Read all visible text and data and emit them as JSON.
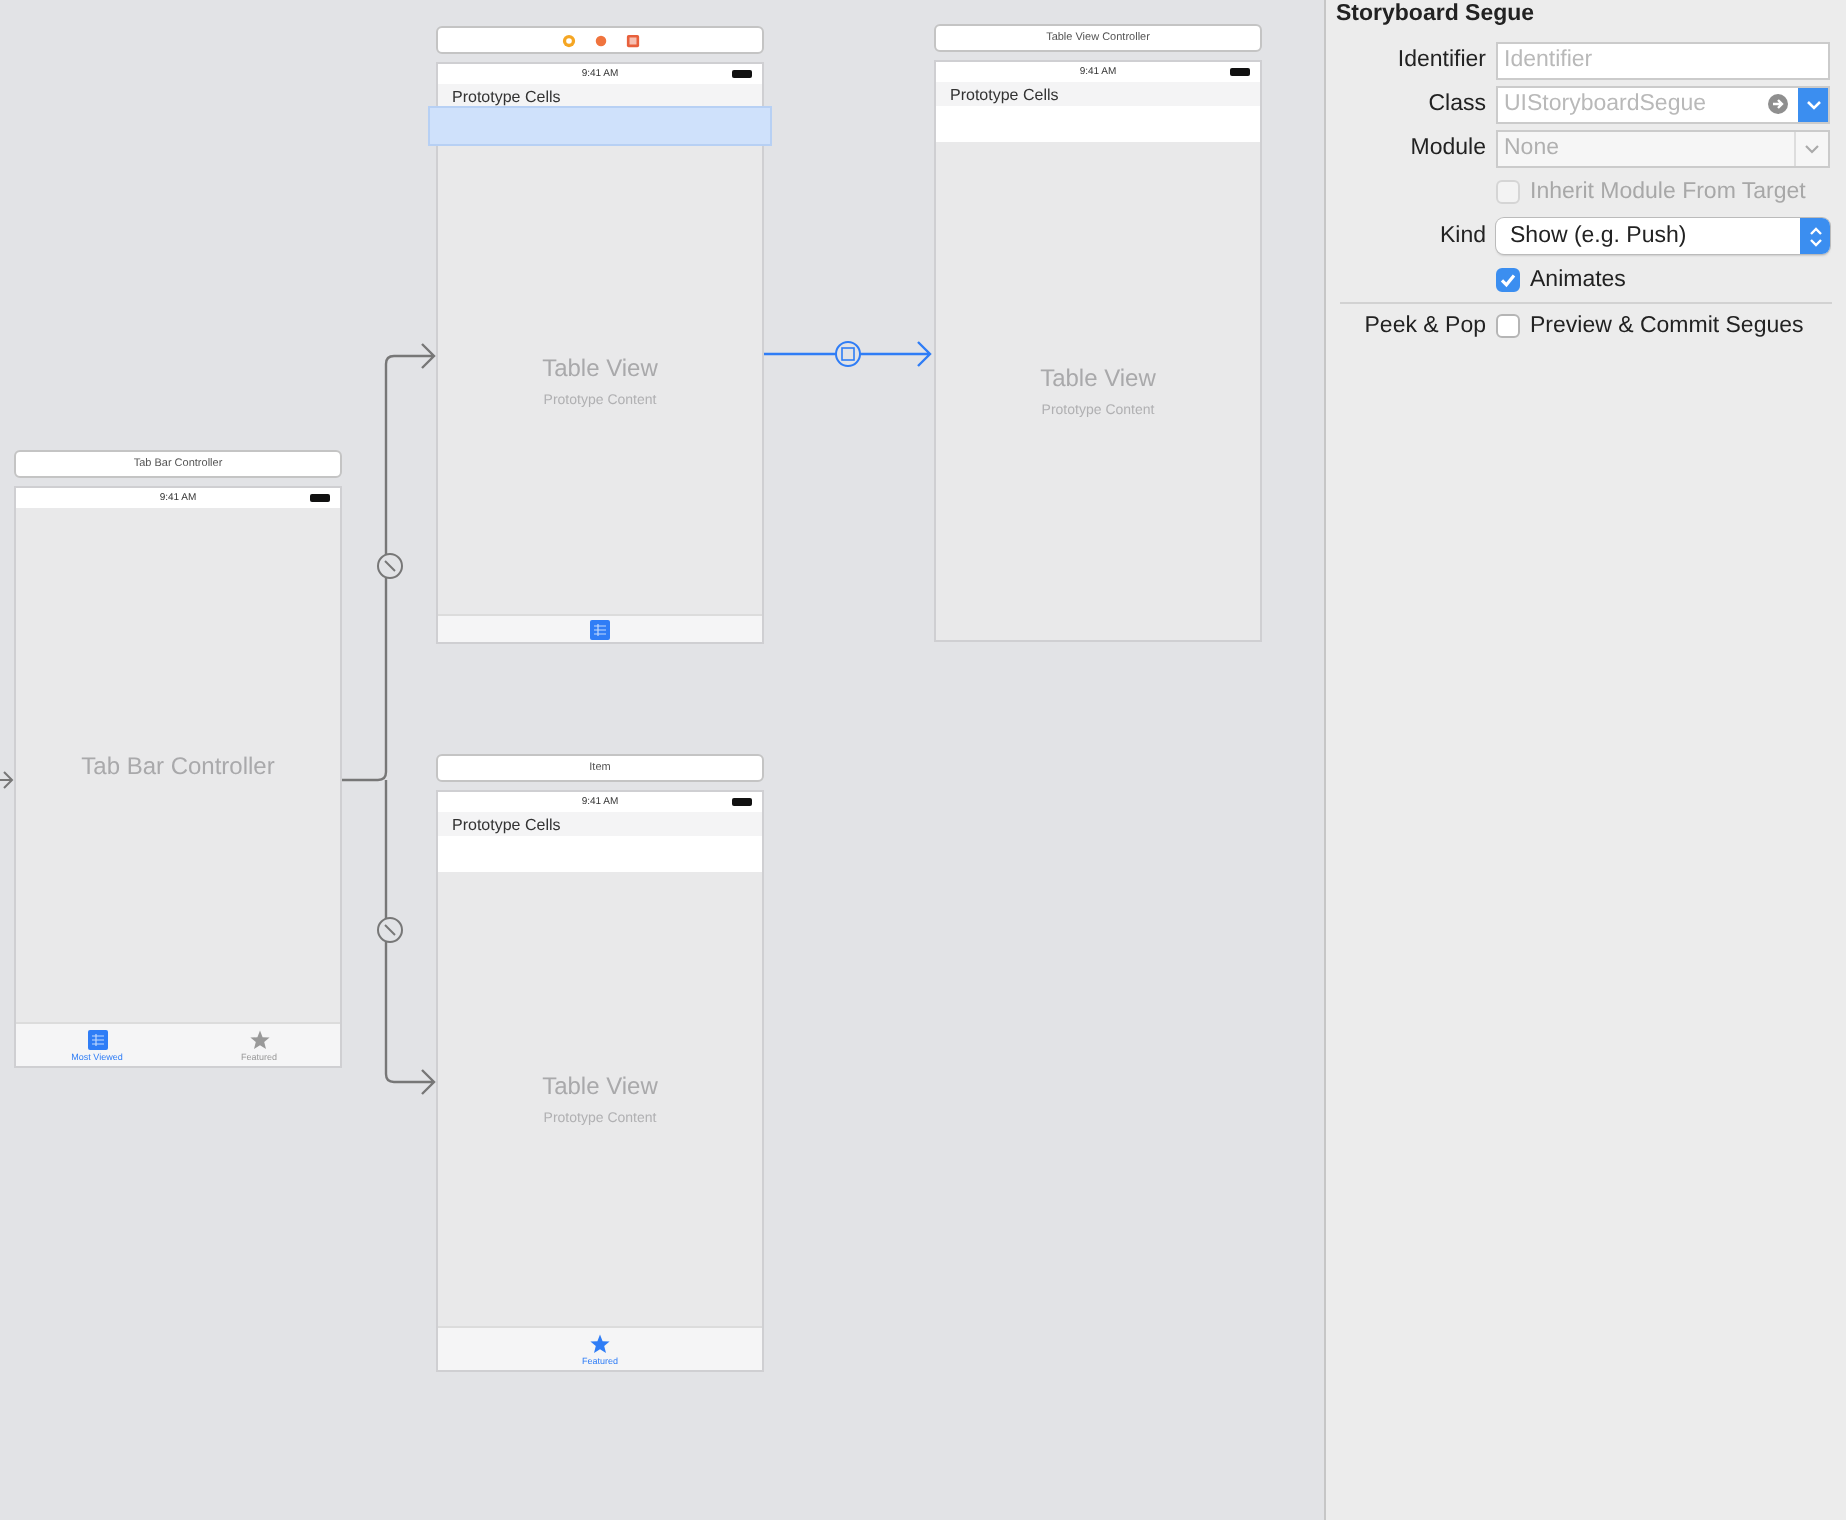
{
  "canvas": {
    "scenes": [
      {
        "kind": "tab_bar_controller",
        "title": "Tab Bar Controller",
        "status_time": "9:41 AM",
        "label": "Tab Bar Controller",
        "tab_items": [
          {
            "kind": "list",
            "label": "Most Viewed",
            "selected": true
          },
          {
            "kind": "star",
            "label": "Featured",
            "selected": false
          }
        ]
      },
      {
        "kind": "table_view",
        "dock": true,
        "status_time": "9:41 AM",
        "section_header": "Prototype Cells",
        "cell_selected": true,
        "label": "Table View",
        "sublabel": "Prototype Content",
        "tab_items": [
          {
            "kind": "list",
            "selected": true
          }
        ]
      },
      {
        "kind": "table_view",
        "title": "Table View Controller",
        "status_time": "9:41 AM",
        "section_header": "Prototype Cells",
        "cell_selected": false,
        "label": "Table View",
        "sublabel": "Prototype Content"
      },
      {
        "kind": "table_view",
        "title": "Item",
        "status_time": "9:41 AM",
        "section_header": "Prototype Cells",
        "cell_selected": false,
        "label": "Table View",
        "sublabel": "Prototype Content",
        "tab_items": [
          {
            "kind": "star",
            "label": "Featured",
            "selected": true
          }
        ]
      }
    ],
    "segues": [
      {
        "selected": false
      },
      {
        "selected": false
      },
      {
        "selected": true
      }
    ]
  },
  "inspector": {
    "title": "Storyboard Segue",
    "rows": [
      {
        "kind": "text",
        "label": "Identifier",
        "placeholder": "Identifier"
      },
      {
        "kind": "combo",
        "label": "Class",
        "placeholder": "UIStoryboardSegue"
      },
      {
        "kind": "dropdown",
        "label": "Module",
        "value": "None",
        "disabled": true
      },
      {
        "kind": "checkbox",
        "text": "Inherit Module From Target",
        "checked": false,
        "disabled": true
      },
      {
        "kind": "popup",
        "label": "Kind",
        "value": "Show (e.g. Push)"
      },
      {
        "kind": "checkbox",
        "text": "Animates",
        "checked": true,
        "disabled": false
      },
      {
        "kind": "checkbox",
        "label": "Peek & Pop",
        "text": "Preview & Commit Segues",
        "checked": false,
        "disabled": false,
        "separated": true
      }
    ]
  }
}
